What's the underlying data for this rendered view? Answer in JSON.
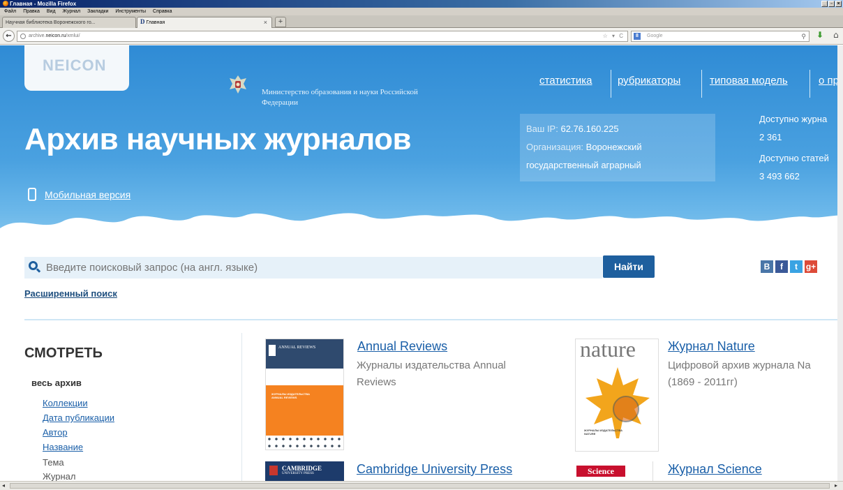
{
  "window": {
    "title": "Главная - Mozilla Firefox"
  },
  "menu": [
    "Файл",
    "Правка",
    "Вид",
    "Журнал",
    "Закладки",
    "Инструменты",
    "Справка"
  ],
  "tabs": [
    {
      "label": "Научная библиотека Воронежского го..."
    },
    {
      "label": "Главная"
    }
  ],
  "address": {
    "prefix": "archive.",
    "host": "neicon.ru",
    "path": "/xmlui/"
  },
  "browser_search": {
    "engine": "Google",
    "engine_badge": "8"
  },
  "site": {
    "logo": "NEICON",
    "ministry": "Министерство образования и науки Российской Федерации",
    "title": "Архив научных журналов",
    "mobile": "Мобильная версия",
    "nav": [
      "статистика",
      "рубрикаторы",
      "типовая модель",
      "о пр"
    ],
    "ip_label": "Ваш IP:",
    "ip_value": "62.76.160.225",
    "org_label": "Организация:",
    "org_value_1": "Воронежский",
    "org_value_2": "государственный аграрный",
    "journals_label": "Доступно журна",
    "journals_value": "2 361",
    "articles_label": "Доступно статей",
    "articles_value": "3 493 662"
  },
  "search": {
    "placeholder": "Введите поисковый запрос (на англ. языке)",
    "button": "Найти",
    "advanced": "Расширенный поиск"
  },
  "social": [
    {
      "label": "B",
      "color": "#4a76a8"
    },
    {
      "label": "f",
      "color": "#3b5998"
    },
    {
      "label": "t",
      "color": "#3aa3e3"
    },
    {
      "label": "g+",
      "color": "#dd4b39"
    }
  ],
  "browse": {
    "title": "СМОТРЕТЬ",
    "all": "весь архив",
    "links": [
      "Коллекции",
      "Дата публикации",
      "Автор",
      "Название"
    ],
    "plain": [
      "Тема",
      "Журнал"
    ]
  },
  "collections": [
    {
      "title": "Annual Reviews",
      "desc_1": "Журналы издательства Annual",
      "desc_2": "Reviews",
      "cover_top": "ANNUAL REVIEWS",
      "cover_mid": "ЖУРНАЛЫ ИЗДАТЕЛЬСТВА ANNUAL REVIEWS"
    },
    {
      "title": "Журнал Nature",
      "desc_1": "Цифровой архив журнала Na",
      "desc_2": "(1869 - 2011гг)",
      "cover_top": "nature",
      "cover_mid": "ЖУРНАЛЫ ИЗДАТЕЛЬСТВА NATURE"
    },
    {
      "title": "Cambridge University Press",
      "cover_top": "CAMBRIDGE",
      "cover_sub": "UNIVERSITY PRESS"
    },
    {
      "title": "Журнал Science",
      "cover_top": "Science"
    }
  ]
}
